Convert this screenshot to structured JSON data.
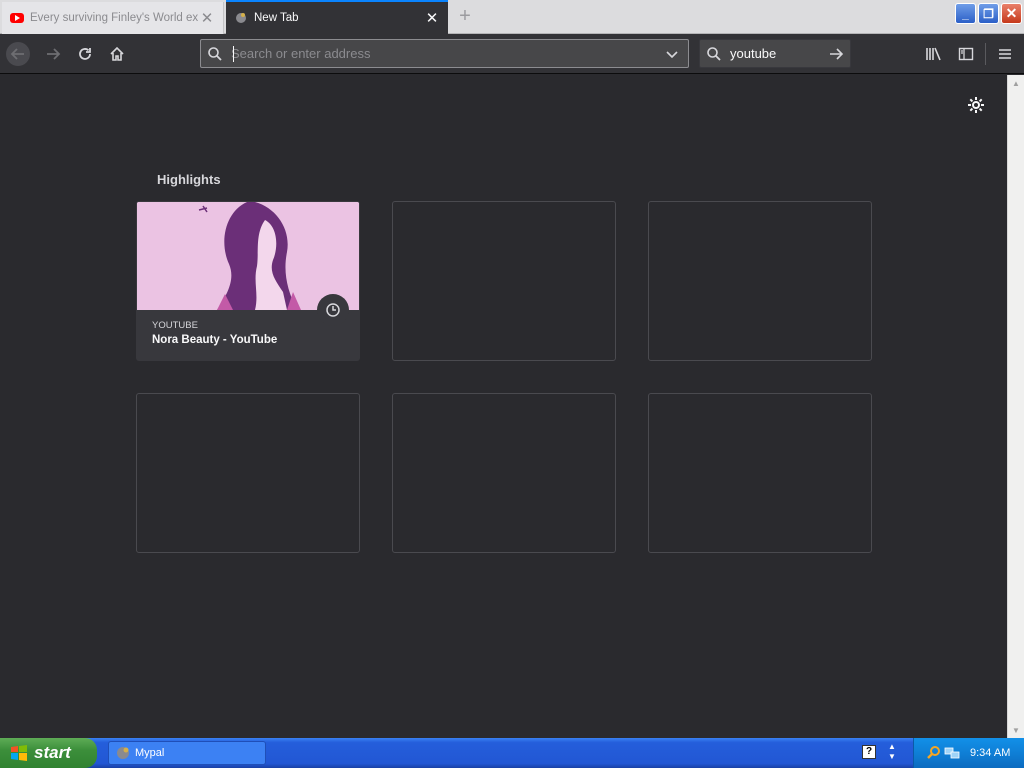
{
  "tabs": [
    {
      "title": "Every surviving Finley's World ex",
      "favicon": "youtube-icon",
      "active": false
    },
    {
      "title": "New Tab",
      "favicon": "new-tab-icon",
      "active": true
    }
  ],
  "toolbar": {
    "url_placeholder": "Search or enter address",
    "search_text": "youtube"
  },
  "content": {
    "section_title": "Highlights",
    "highlights": [
      {
        "host": "YOUTUBE",
        "title": "Nora Beauty - YouTube",
        "bookmark_icon": "clock-icon"
      }
    ],
    "empty_slots": 5
  },
  "taskbar": {
    "start_label": "start",
    "task_button_label": "Mypal",
    "clock": "9:34 AM",
    "help_glyph": "?"
  },
  "colors": {
    "page_background": "#2a2a2e",
    "toolbar": "#323236",
    "active_tab_accent": "#0a84ff",
    "card_image": "#ebc3e3"
  }
}
